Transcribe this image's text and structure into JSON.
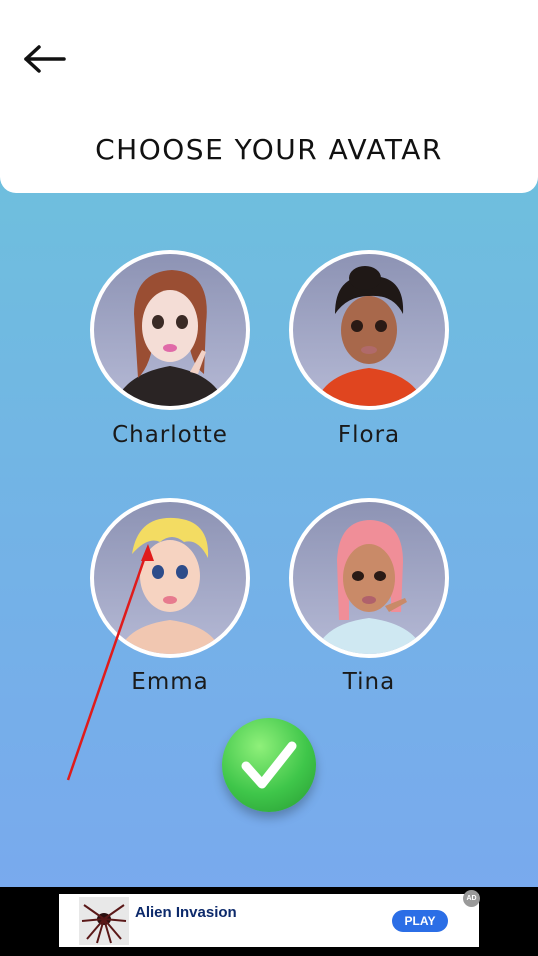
{
  "header": {
    "title": "CHOOSE YOUR AVATAR",
    "back_icon": "arrow-left-icon"
  },
  "avatars": [
    {
      "name": "Charlotte"
    },
    {
      "name": "Flora"
    },
    {
      "name": "Emma"
    },
    {
      "name": "Tina"
    }
  ],
  "confirm": {
    "icon": "checkmark-icon",
    "color": "#3fc64a"
  },
  "ad": {
    "title": "Alien Invasion",
    "play_label": "PLAY",
    "badge": "AD"
  },
  "colors": {
    "bg_top": "#6cc5d9",
    "bg_bottom": "#7aa8ef",
    "annotation": "#e01b1b"
  }
}
